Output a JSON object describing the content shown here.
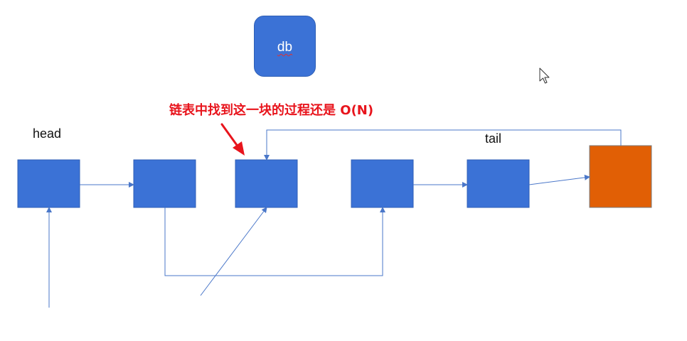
{
  "db_node": {
    "label": "db"
  },
  "labels": {
    "head": "head",
    "tail": "tail",
    "annotation": "链表中找到这一块的过程还是 O(N)"
  },
  "colors": {
    "node_fill": "#3b72d6",
    "tail_node_fill": "#e15f05",
    "connector": "#4a77c9",
    "annotation": "#e8141c"
  },
  "icons": {
    "cursor": "mouse-pointer-icon",
    "annotation_arrow": "red-arrow-icon"
  }
}
